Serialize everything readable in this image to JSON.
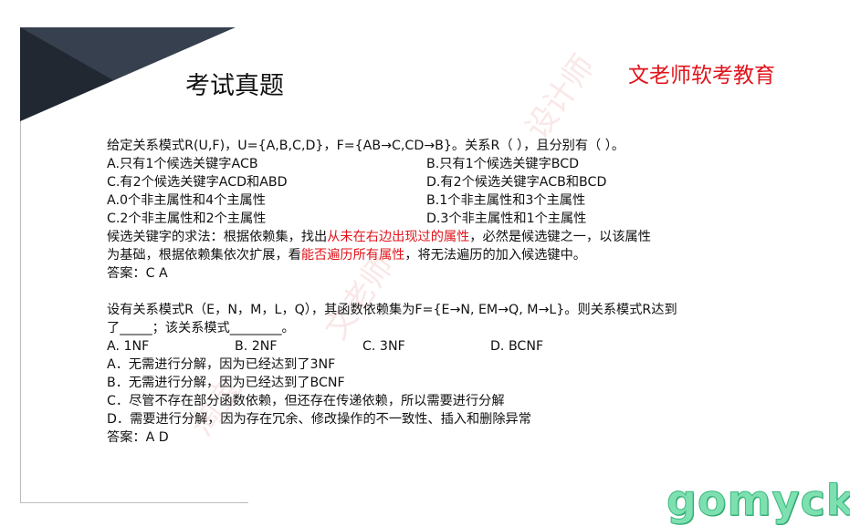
{
  "header": {
    "title": "考试真题",
    "brand": "文老师软考教育"
  },
  "q1": {
    "stem": "给定关系模式R(U,F)，U={A,B,C,D}，F={AB→C,CD→B}。关系R（ ），且分别有（ ）。",
    "options_1": [
      [
        "A.只有1个候选关键字ACB",
        "B.只有1个候选关键字BCD"
      ],
      [
        "C.有2个候选关键字ACD和ABD",
        "D.有2个候选关键字ACB和BCD"
      ]
    ],
    "options_2": [
      [
        "A.0个非主属性和4个主属性",
        "B.1个非主属性和3个主属性"
      ],
      [
        "C.2个非主属性和2个主属性",
        "D.3个非主属性和1个主属性"
      ]
    ],
    "explain": {
      "p1": "候选关键字的求法：根据依赖集，找出",
      "r1": "从未在右边出现过的属性",
      "p2": "，必然是候选键之一，以该属性",
      "p3": "为基础，根据依赖集依次扩展，看",
      "r2": "能否遍历所有属性",
      "p4": "，将无法遍历的加入候选键中。"
    },
    "answer": "答案：C A"
  },
  "q2": {
    "stem_line1": "设有关系模式R（E，N，M，L，Q），其函数依赖集为F={E→N, EM→Q, M→L}。则关系模式R达到",
    "stem_line2": "了_____；该关系模式________。",
    "options_1": [
      "A.  1NF",
      "B. 2NF",
      "C. 3NF",
      "D. BCNF"
    ],
    "options_2": [
      "A．无需进行分解，因为已经达到了3NF",
      "B．无需进行分解，因为已经达到了BCNF",
      "C．尽管不存在部分函数依赖，但还存在传递依赖，所以需要进行分解",
      "D．需要进行分解，因为存在冗余、修改操作的不一致性、插入和删除异常"
    ],
    "answer": "答案：A D"
  },
  "watermark": {
    "text": "gomyck",
    "faint": [
      "淘宝",
      "文老师",
      "设计师"
    ]
  },
  "colors": {
    "accent": "#e0141b",
    "corner_light": "#36404f",
    "corner_dark": "#222832",
    "watermark": "#7ee0b0"
  }
}
